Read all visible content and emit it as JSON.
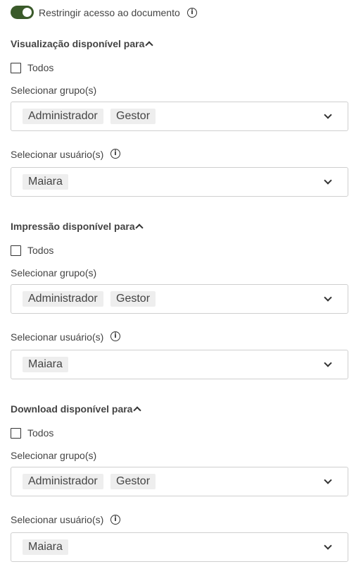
{
  "toggle": {
    "label": "Restringir acesso ao documento",
    "checked": true,
    "color": "#3a5a2a"
  },
  "sections": [
    {
      "title": "Visualização disponível para",
      "all_label": "Todos",
      "groups_label": "Selecionar grupo(s)",
      "groups": [
        "Administrador",
        "Gestor"
      ],
      "users_label": "Selecionar usuário(s)",
      "users": [
        "Maiara"
      ]
    },
    {
      "title": "Impressão disponível para",
      "all_label": "Todos",
      "groups_label": "Selecionar grupo(s)",
      "groups": [
        "Administrador",
        "Gestor"
      ],
      "users_label": "Selecionar usuário(s)",
      "users": [
        "Maiara"
      ]
    },
    {
      "title": "Download disponível para",
      "all_label": "Todos",
      "groups_label": "Selecionar grupo(s)",
      "groups": [
        "Administrador",
        "Gestor"
      ],
      "users_label": "Selecionar usuário(s)",
      "users": [
        "Maiara"
      ]
    }
  ]
}
